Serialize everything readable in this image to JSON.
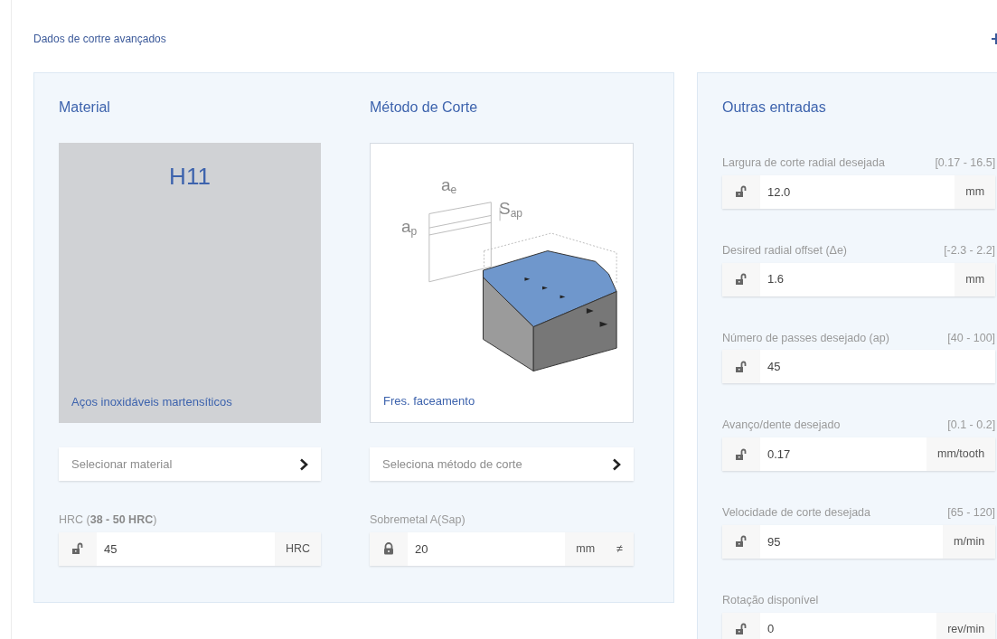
{
  "header": {
    "title": "Dados de cortre avançados"
  },
  "material": {
    "heading": "Material",
    "card": {
      "code": "H11",
      "name": "Aços inoxidáveis martensíticos"
    },
    "select": "Selecionar material",
    "field": {
      "label": "HRC (**38 - 50 HRC**)",
      "value": "45",
      "unit": "HRC",
      "locked": false
    }
  },
  "method": {
    "heading": "Método de Corte",
    "card": {
      "name": "Fres. faceamento",
      "labels": [
        "a$_{e}$",
        "S$_{ap}$",
        "a$_{p}$"
      ]
    },
    "select": "Seleciona método de corte",
    "field": {
      "label": "Sobremetal A(Sap)",
      "value": "20",
      "unit": "mm",
      "extra": "≠",
      "locked": true
    }
  },
  "other": {
    "heading": "Outras entradas",
    "fields": [
      {
        "label": "Largura de corte radial desejada",
        "range": "[0.17 - 16.5]",
        "value": "12.0",
        "unit": "mm",
        "locked": false
      },
      {
        "label": "Desired radial offset (Δe)",
        "range": "[-2.3 - 2.2]",
        "value": "1.6",
        "unit": "mm",
        "locked": false
      },
      {
        "label": "Número de passes desejado (ap)",
        "range": "[40 - 100]",
        "value": "45",
        "locked": false
      },
      {
        "label": "Avanço/dente desejado",
        "range": "[0.1 - 0.2]",
        "value": "0.17",
        "unit": "mm/tooth",
        "locked": false
      },
      {
        "label": "Velocidade de corte desejada",
        "range": "[65 - 120]",
        "value": "95",
        "unit": "m/min",
        "locked": false
      },
      {
        "label": "Rotação disponível",
        "value": "0",
        "unit": "rev/min",
        "locked": false
      }
    ]
  }
}
